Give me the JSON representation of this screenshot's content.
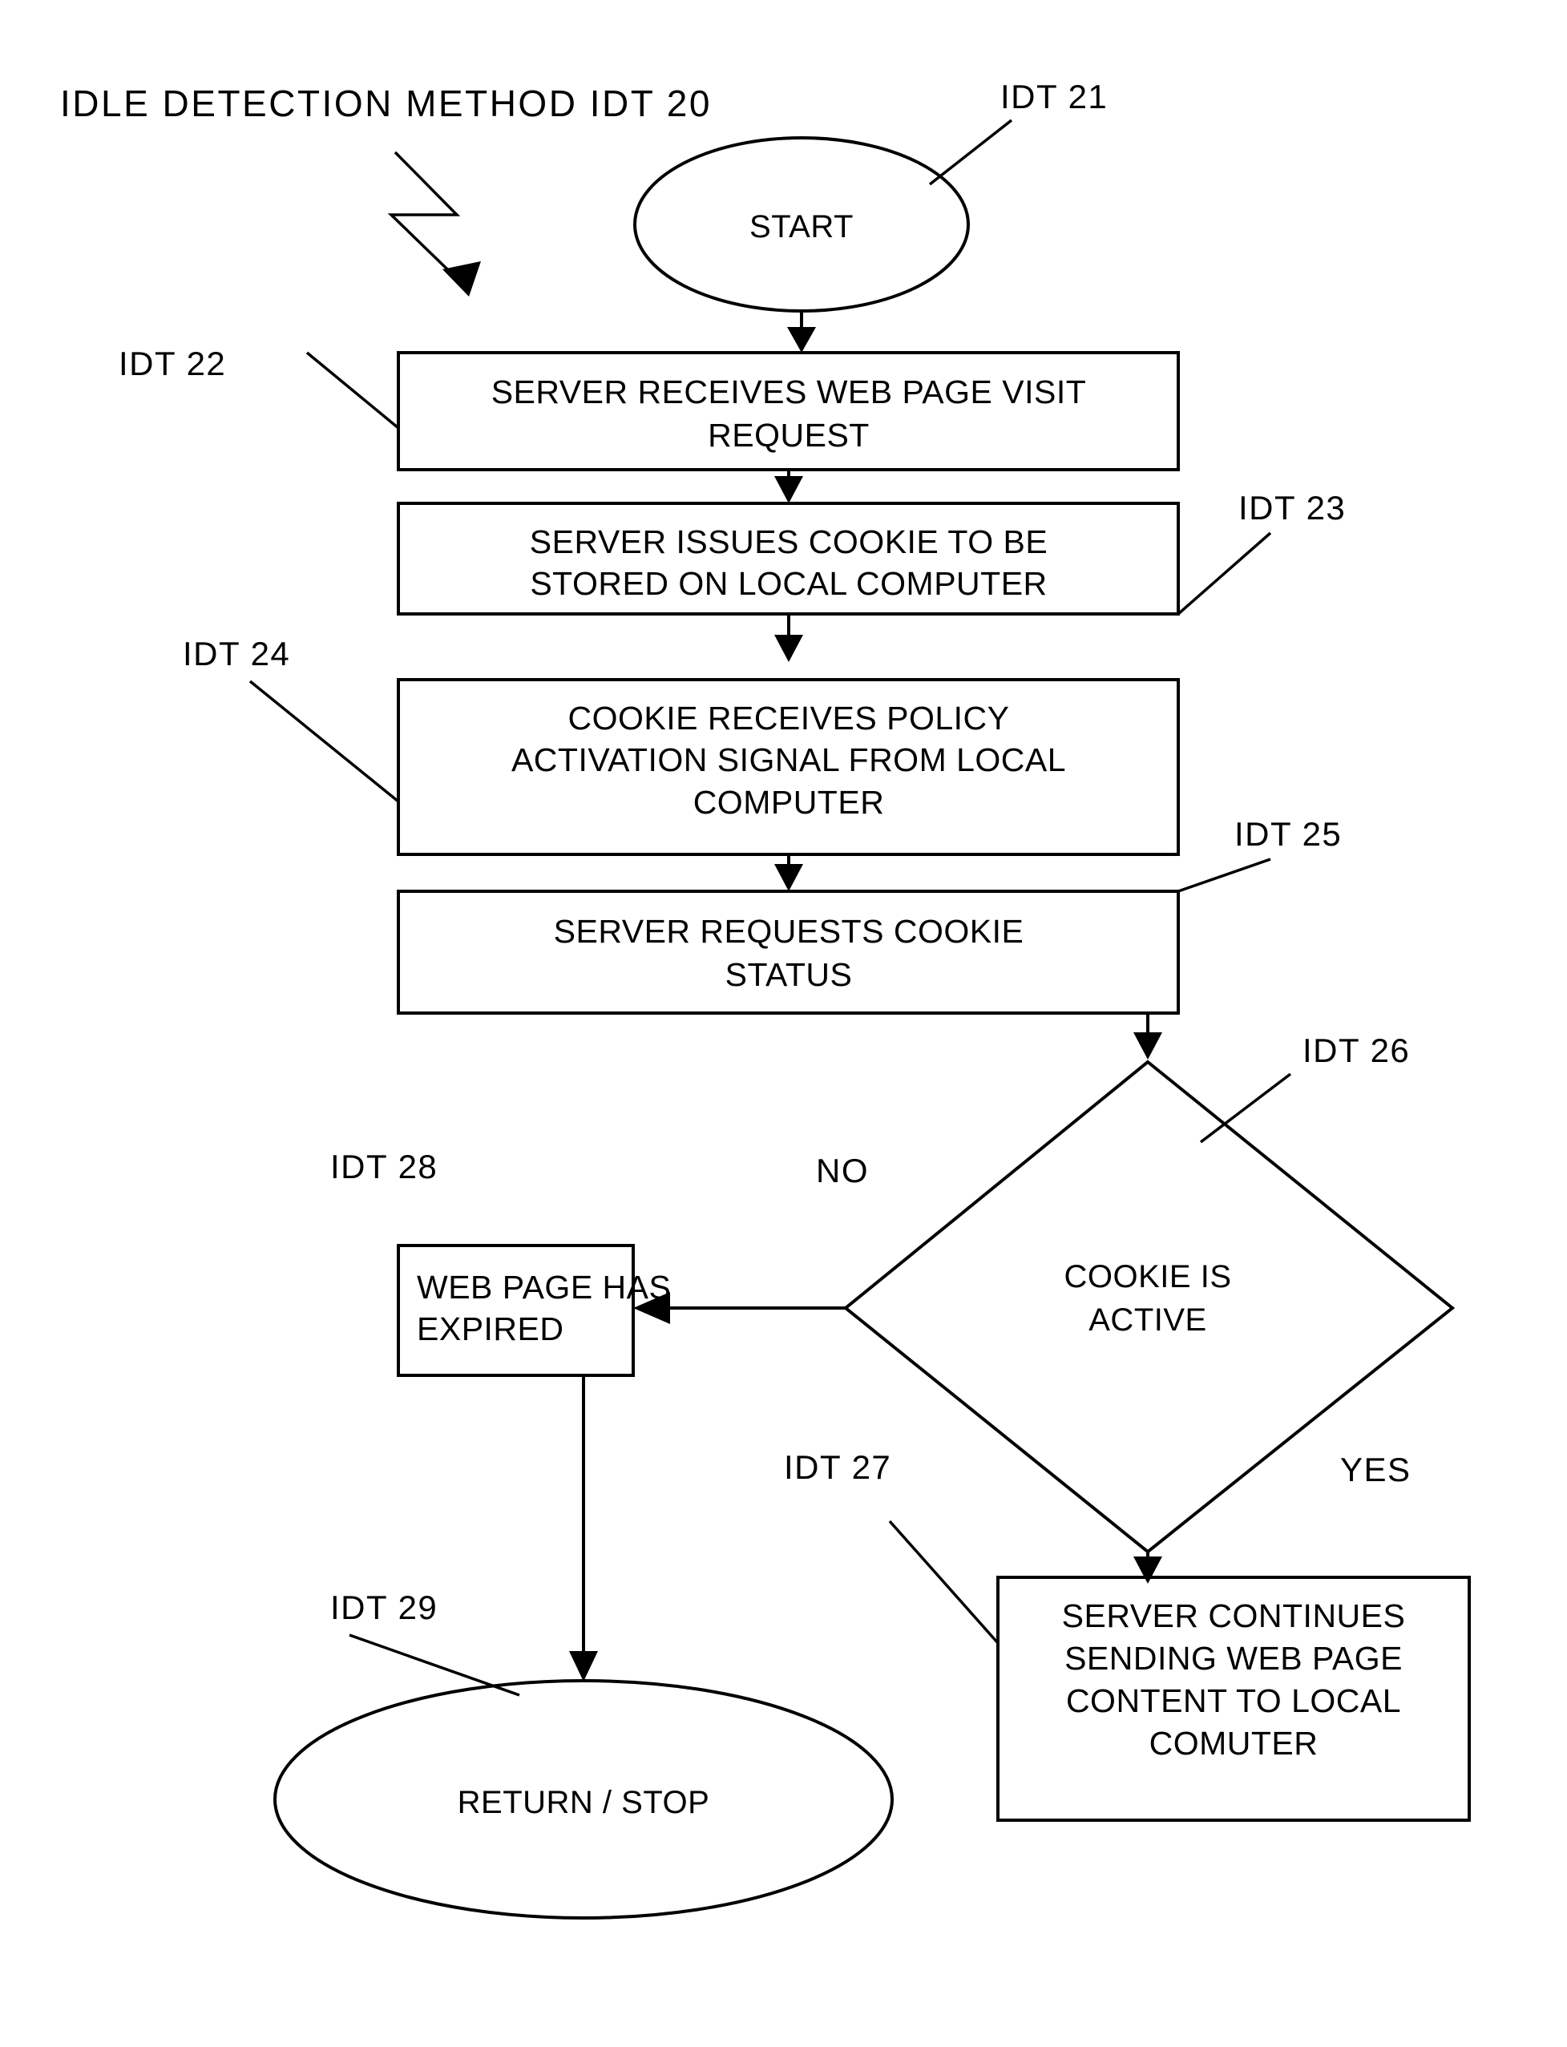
{
  "figure": {
    "title": "IDLE  DETECTION  METHOD  IDT  20",
    "background_color": "#ffffff",
    "line_color": "#000000"
  },
  "nodes": {
    "start": {
      "ref": "IDT  21",
      "label": "START",
      "shape": "ellipse"
    },
    "step22": {
      "ref": "IDT  22",
      "shape": "process",
      "line1": "SERVER RECEIVES WEB PAGE VISIT",
      "line2": "REQUEST"
    },
    "step23": {
      "ref": "IDT  23",
      "shape": "process",
      "line1": "SERVER ISSUES COOKIE TO BE",
      "line2": "STORED ON LOCAL COMPUTER"
    },
    "step24": {
      "ref": "IDT  24",
      "shape": "process",
      "line1": "COOKIE RECEIVES POLICY",
      "line2": "ACTIVATION SIGNAL FROM LOCAL",
      "line3": "COMPUTER"
    },
    "step25": {
      "ref": "IDT  25",
      "shape": "process",
      "line1": "SERVER REQUESTS COOKIE",
      "line2": "STATUS"
    },
    "decision26": {
      "ref": "IDT  26",
      "shape": "diamond",
      "line1": "COOKIE IS",
      "line2": "ACTIVE"
    },
    "step27": {
      "ref": "IDT  27",
      "shape": "process",
      "line1": "SERVER CONTINUES",
      "line2": "SENDING WEB PAGE",
      "line3": "CONTENT TO LOCAL",
      "line4": "COMUTER"
    },
    "step28": {
      "ref": "IDT  28",
      "shape": "process",
      "line1": "WEB PAGE HAS",
      "line2": "EXPIRED"
    },
    "stop29": {
      "ref": "IDT  29",
      "label": "RETURN / STOP",
      "shape": "ellipse"
    }
  },
  "branch_labels": {
    "no": "NO",
    "yes": "YES"
  }
}
